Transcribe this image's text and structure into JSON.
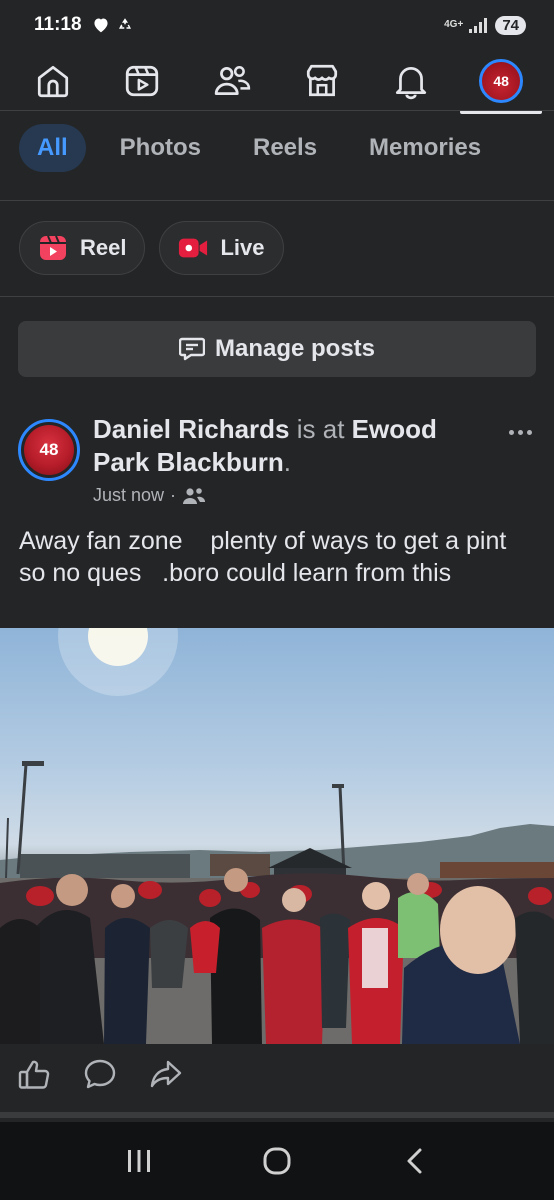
{
  "status_bar": {
    "time": "11:18",
    "network": "4G+",
    "battery": "74",
    "icons": [
      "heart-icon",
      "recycle-icon",
      "signal-icon"
    ]
  },
  "top_nav": {
    "items": [
      {
        "name": "home-icon"
      },
      {
        "name": "video-icon"
      },
      {
        "name": "friends-icon"
      },
      {
        "name": "marketplace-icon"
      },
      {
        "name": "notifications-icon"
      },
      {
        "name": "profile-avatar",
        "label": "48"
      }
    ]
  },
  "tabs": [
    {
      "label": "All",
      "active": true
    },
    {
      "label": "Photos"
    },
    {
      "label": "Reels"
    },
    {
      "label": "Memories"
    }
  ],
  "create_chips": {
    "reel_label": "Reel",
    "live_label": "Live"
  },
  "manage_posts": {
    "label": "Manage posts"
  },
  "post": {
    "author": "Daniel Richards",
    "connector": " is at ",
    "place": "Ewood Park Blackburn",
    "period": ".",
    "time": "Just now",
    "separator": "·",
    "audience_icon": "friends-audience-icon",
    "avatar_label": "48",
    "text": "Away fan zone    plenty of ways to get a pint so no ques   .boro could learn from this"
  },
  "actions": [
    "like-icon",
    "comment-icon",
    "share-icon"
  ],
  "system_nav": [
    "recents-icon",
    "home-circle-icon",
    "back-icon"
  ],
  "colors": {
    "background": "#242526",
    "accent_blue": "#2d88ff",
    "active_tab_bg": "#263951",
    "active_tab_text": "#4599ff",
    "reel_red": "#f3425f",
    "live_red": "#e41e3f"
  }
}
